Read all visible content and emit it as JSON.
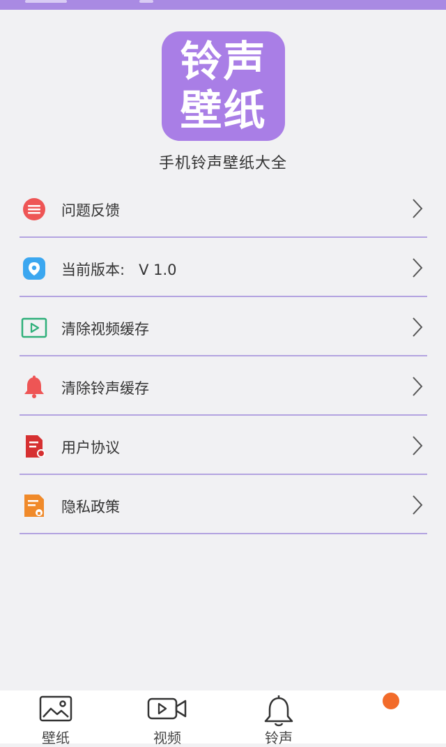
{
  "logo": {
    "line1": "铃声",
    "line2": "壁纸"
  },
  "app_name": "手机铃声壁纸大全",
  "menu": [
    {
      "label": "问题反馈",
      "icon": "feedback-icon",
      "color": "#ee5555"
    },
    {
      "label": "当前版本:   V 1.0",
      "icon": "shield-icon",
      "color": "#3ba7f0"
    },
    {
      "label": "清除视频缓存",
      "icon": "video-play-icon",
      "color": "#2fb07a"
    },
    {
      "label": "清除铃声缓存",
      "icon": "bell-icon",
      "color": "#ee5555"
    },
    {
      "label": "用户协议",
      "icon": "document-icon",
      "color": "#d63031"
    },
    {
      "label": "隐私政策",
      "icon": "privacy-document-icon",
      "color": "#f08a2a"
    }
  ],
  "bottom_nav": [
    {
      "label": "壁纸",
      "icon": "image-icon"
    },
    {
      "label": "视频",
      "icon": "video-camera-icon"
    },
    {
      "label": "铃声",
      "icon": "bell-outline-icon"
    }
  ],
  "colors": {
    "accent": "#a97ee6",
    "divider": "#b3a3e0",
    "badge": "#f26b2a"
  }
}
